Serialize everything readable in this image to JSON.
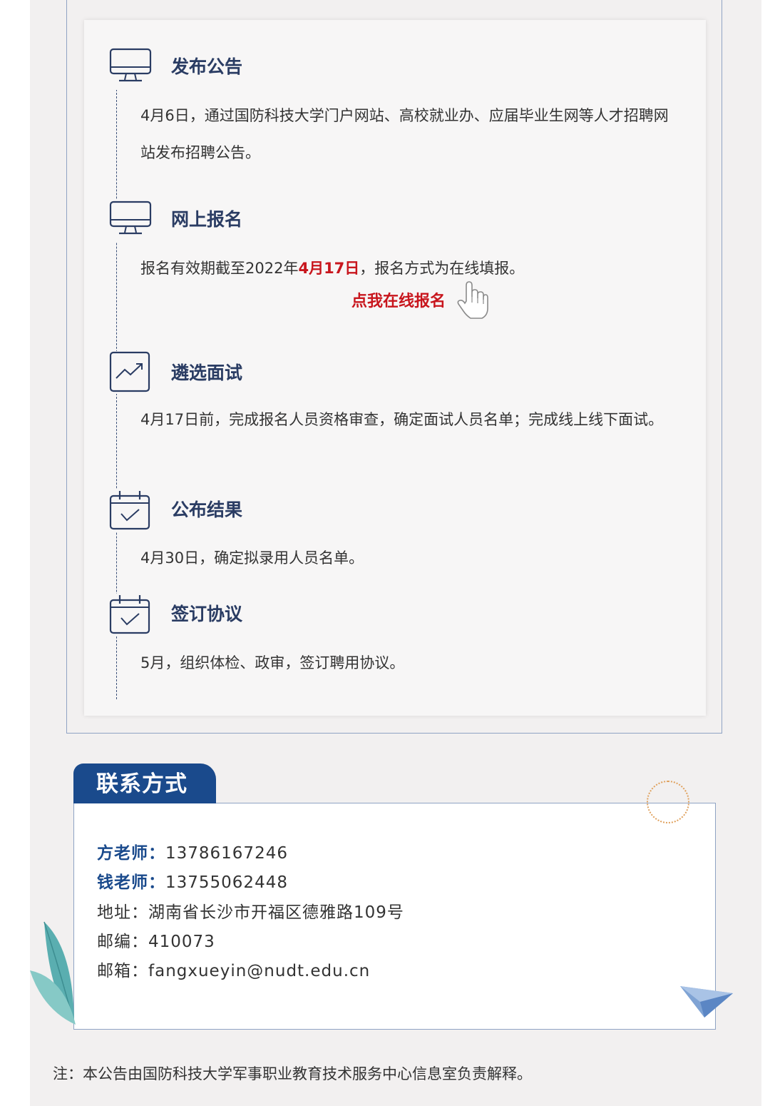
{
  "steps": [
    {
      "title": "发布公告",
      "desc": "4月6日，通过国防科技大学门户网站、高校就业办、应届毕业生网等人才招聘网站发布招聘公告。",
      "icon": "monitor-icon"
    },
    {
      "title": "网上报名",
      "desc_before": "报名有效期截至2022年",
      "desc_highlight": "4月17日",
      "desc_after": "，报名方式为在线填报。",
      "icon": "monitor-icon"
    },
    {
      "title": "遴选面试",
      "desc": "4月17日前，完成报名人员资格审查，确定面试人员名单；完成线上线下面试。",
      "icon": "trend-chart-icon"
    },
    {
      "title": "公布结果",
      "desc": "4月30日，确定拟录用人员名单。",
      "icon": "calendar-check-icon"
    },
    {
      "title": "签订协议",
      "desc": "5月，组织体检、政审，签订聘用协议。",
      "icon": "calendar-check-icon"
    }
  ],
  "signup_link": "点我在线报名",
  "contact": {
    "heading": "联系方式",
    "teacher1_label": "方老师：",
    "teacher1_phone": "13786167246",
    "teacher2_label": "钱老师：",
    "teacher2_phone": "13755062448",
    "address_label": "地址：",
    "address": "湖南省长沙市开福区德雅路109号",
    "postcode_label": "邮编：",
    "postcode": "410073",
    "email_label": "邮箱：",
    "email": "fangxueyin@nudt.edu.cn"
  },
  "footnote": "注：本公告由国防科技大学军事职业教育技术服务中心信息室负责解释。",
  "colors": {
    "navy": "#2a3c63",
    "brand_blue": "#1a4a8c",
    "highlight_red": "#c8161d"
  }
}
